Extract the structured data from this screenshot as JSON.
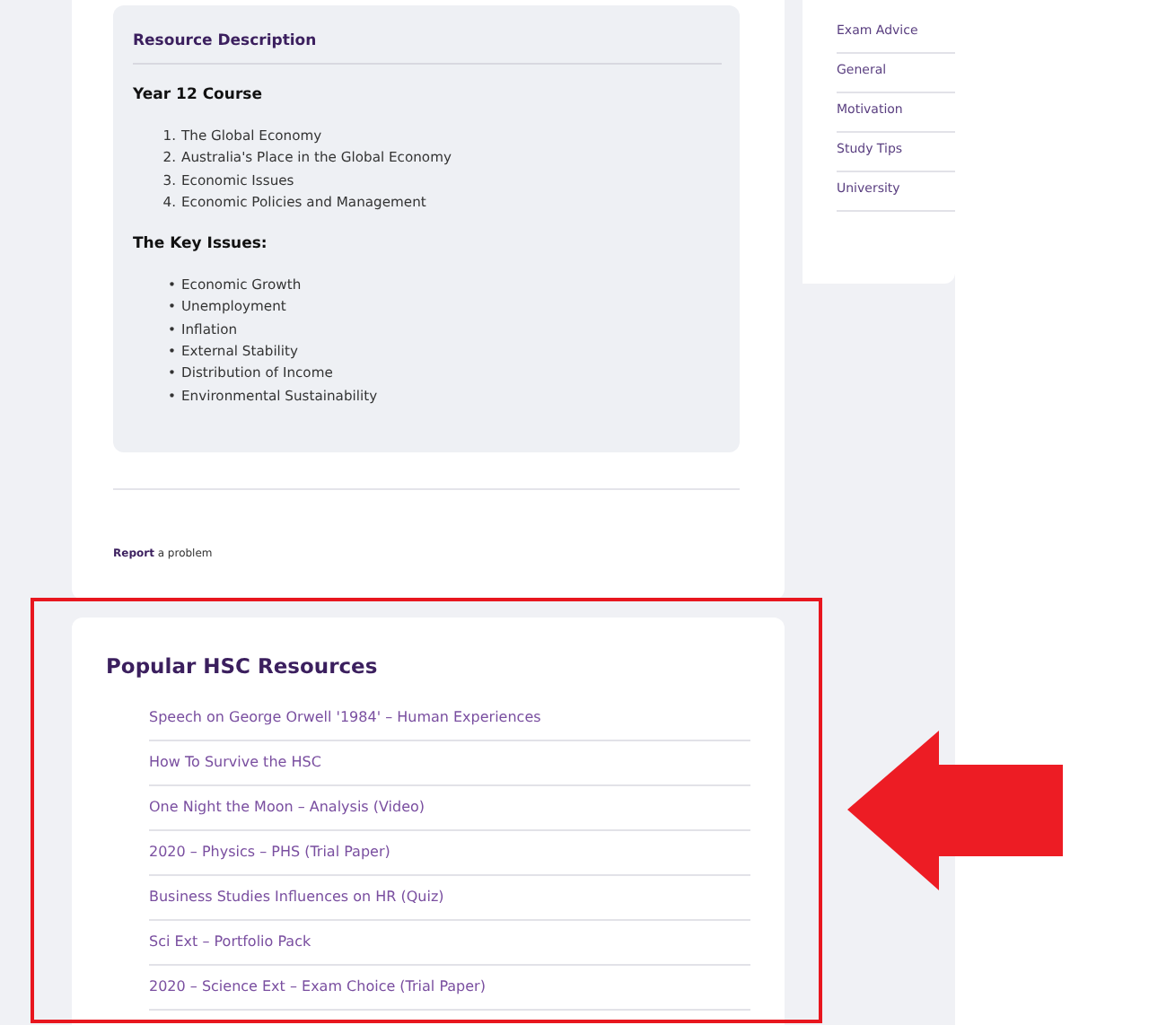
{
  "description": {
    "title": "Resource Description",
    "course_heading": "Year 12 Course",
    "course_topics": [
      {
        "marker": "1.",
        "text": "The Global Economy"
      },
      {
        "marker": "2.",
        "text": "Australia's Place in the Global Economy"
      },
      {
        "marker": "3.",
        "text": "Economic Issues"
      },
      {
        "marker": "4.",
        "text": "Economic Policies and Management"
      }
    ],
    "issues_heading": "The Key Issues:",
    "issues": [
      {
        "marker": "•",
        "text": "Economic Growth"
      },
      {
        "marker": "•",
        "text": "Unemployment"
      },
      {
        "marker": "•",
        "text": "Inflation"
      },
      {
        "marker": "•",
        "text": "External Stability"
      },
      {
        "marker": "•",
        "text": "Distribution of Income"
      },
      {
        "marker": "•",
        "text": "Environmental Sustainability"
      }
    ]
  },
  "report": "**Report** a problem",
  "sidebar": {
    "items": [
      "Exam Advice",
      "General",
      "Motivation",
      "Study Tips",
      "University"
    ]
  },
  "popular": {
    "title": "Popular HSC Resources",
    "items": [
      "Speech on George Orwell '1984' – Human Experiences",
      "How To Survive the HSC",
      "One Night the Moon – Analysis (Video)",
      "2020 – Physics – PHS (Trial Paper)",
      "Business Studies Influences on HR (Quiz)",
      "Sci Ext – Portfolio Pack",
      "2020 – Science Ext – Exam Choice (Trial Paper)"
    ]
  },
  "annotation": {
    "highlight": true
  }
}
